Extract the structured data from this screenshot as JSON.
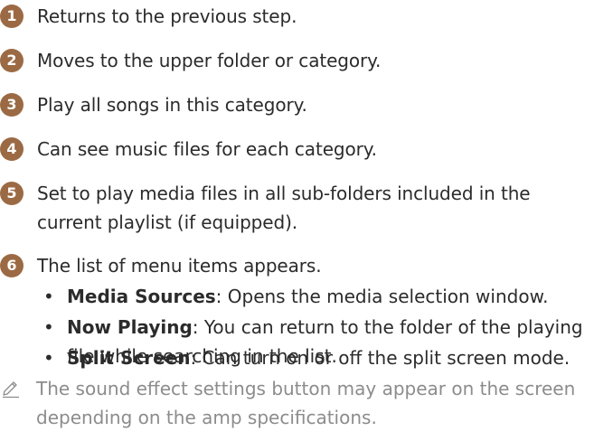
{
  "items": [
    {
      "num": "1",
      "text": "Returns to the previous step."
    },
    {
      "num": "2",
      "text": "Moves to the upper folder or category."
    },
    {
      "num": "3",
      "text": "Play all songs in this category."
    },
    {
      "num": "4",
      "text": "Can see music files for each category."
    },
    {
      "num": "5",
      "text": "Set to play media files in all sub-folders included in the current playlist (if equipped)."
    },
    {
      "num": "6",
      "text": "The list of menu items appears."
    }
  ],
  "sub_items": [
    {
      "bullet": "•",
      "label": "Media Sources",
      "text": ": Opens the media selection window."
    },
    {
      "bullet": "•",
      "label": "Now Playing",
      "text": ": You can return to the folder of the playing file while searching in the list."
    },
    {
      "bullet": "•",
      "label": "Split Screen",
      "text": ": Can turn on or off the split screen mode."
    }
  ],
  "note": {
    "icon": "pencil-note-icon",
    "text": "The sound effect settings button may appear on the screen depending on the amp specifications."
  },
  "colors": {
    "accent": "#9b6a44",
    "text": "#2b2b2b",
    "note": "#8c8c8c"
  }
}
